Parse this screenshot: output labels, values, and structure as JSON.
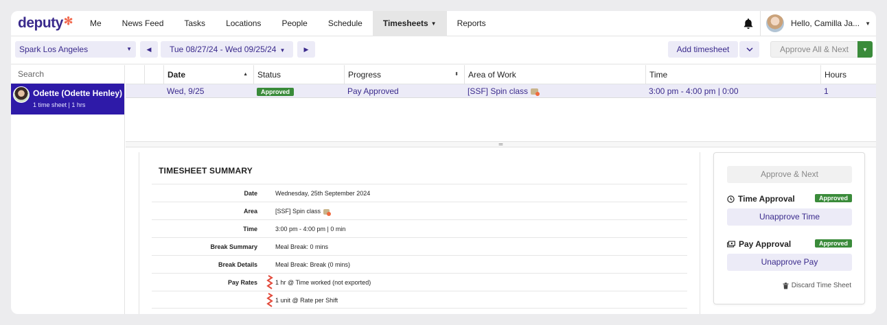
{
  "nav": {
    "logo": "deputy",
    "items": [
      "Me",
      "News Feed",
      "Tasks",
      "Locations",
      "People",
      "Schedule",
      "Timesheets",
      "Reports"
    ],
    "active": "Timesheets",
    "user_greeting": "Hello, Camilla Ja..."
  },
  "toolbar": {
    "location": "Spark Los Angeles",
    "date_range": "Tue 08/27/24 - Wed 09/25/24",
    "add_timesheet": "Add timesheet",
    "approve_all_next": "Approve All & Next"
  },
  "sidebar": {
    "search_placeholder": "Search",
    "employee": {
      "name": "Odette (Odette Henley)",
      "meta": "1 time sheet | 1 hrs"
    }
  },
  "table": {
    "columns": [
      "Date",
      "Status",
      "Progress",
      "Area of Work",
      "Time",
      "Hours"
    ],
    "rows": [
      {
        "date": "Wed, 9/25",
        "status": "Approved",
        "progress": "Pay Approved",
        "area": "[SSF] Spin class",
        "time": "3:00 pm - 4:00 pm | 0:00",
        "hours": "1"
      }
    ]
  },
  "summary": {
    "title": "TIMESHEET SUMMARY",
    "rows": [
      {
        "label": "Date",
        "value": "Wednesday, 25th September 2024"
      },
      {
        "label": "Area",
        "value": "[SSF] Spin class"
      },
      {
        "label": "Time",
        "value": "3:00 pm - 4:00 pm | 0 min"
      },
      {
        "label": "Break Summary",
        "value": "Meal Break: 0 mins"
      },
      {
        "label": "Break Details",
        "value": "Meal Break: Break (0 mins)"
      },
      {
        "label": "Pay Rates",
        "value": "1 hr @ Time worked (not exported)"
      },
      {
        "label": "",
        "value": "1 unit @ Rate per Shift"
      }
    ]
  },
  "approvals": {
    "approve_next": "Approve & Next",
    "time_title": "Time Approval",
    "time_status": "Approved",
    "unapprove_time": "Unapprove Time",
    "pay_title": "Pay Approval",
    "pay_status": "Approved",
    "unapprove_pay": "Unapprove Pay",
    "discard": "Discard Time Sheet"
  },
  "colors": {
    "brand": "#3a2a8c",
    "accent_selected": "#2e1aa8",
    "approved_green": "#3a8b3a",
    "logo_star": "#f26a4f"
  }
}
